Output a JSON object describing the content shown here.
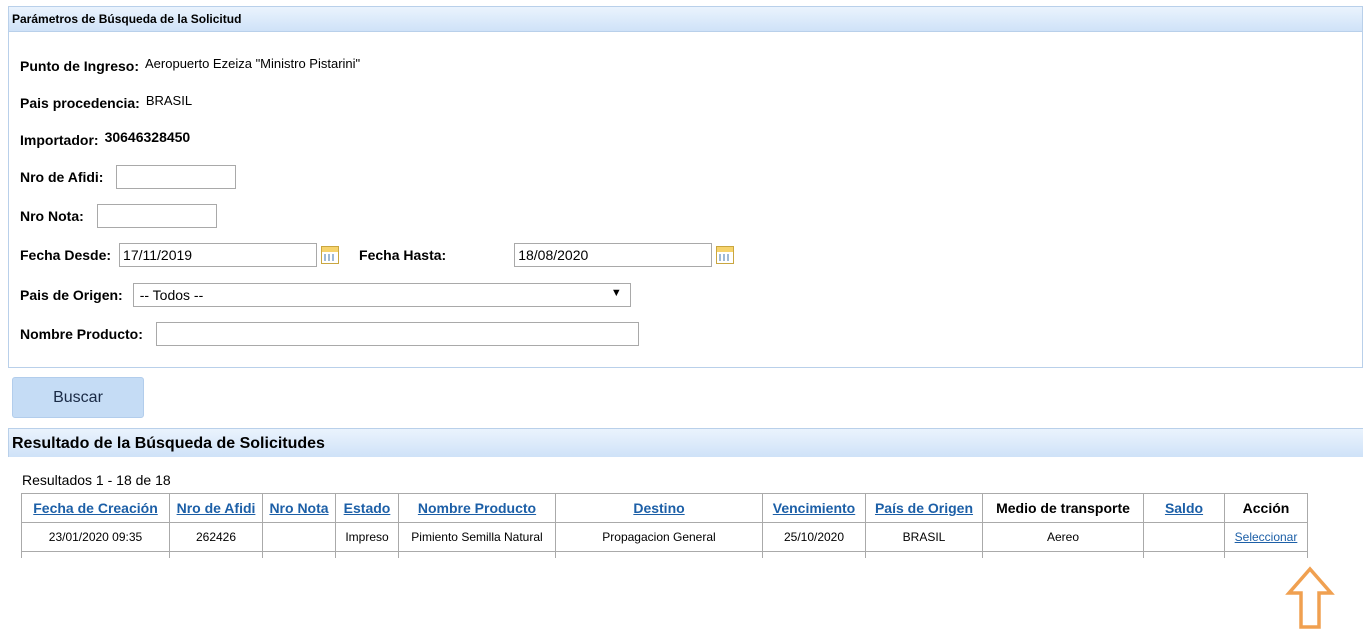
{
  "search_panel": {
    "title": "Parámetros de Búsqueda de la Solicitud",
    "punto_ingreso": {
      "label": "Punto de Ingreso:",
      "value": "Aeropuerto Ezeiza \"Ministro Pistarini\""
    },
    "pais_procedencia": {
      "label": "Pais procedencia:",
      "value": "BRASIL"
    },
    "importador": {
      "label": "Importador:",
      "value": "30646328450"
    },
    "nro_afidi": {
      "label": "Nro de Afidi:",
      "value": ""
    },
    "nro_nota": {
      "label": "Nro Nota:",
      "value": ""
    },
    "fecha_desde": {
      "label": "Fecha Desde:",
      "value": "17/11/2019"
    },
    "fecha_hasta": {
      "label": "Fecha Hasta:",
      "value": "18/08/2020"
    },
    "pais_origen": {
      "label": "Pais de Origen:",
      "selected": "-- Todos --"
    },
    "nombre_producto": {
      "label": "Nombre Producto:",
      "value": ""
    }
  },
  "buscar_label": "Buscar",
  "results_panel": {
    "title": "Resultado de la Búsqueda de Solicitudes",
    "summary": "Resultados 1 - 18 de 18",
    "columns": [
      "Fecha de Creación",
      "Nro de Afidi",
      "Nro Nota",
      "Estado",
      "Nombre Producto",
      "Destino",
      "Vencimiento",
      "País de Origen",
      "Medio de transporte",
      "Saldo",
      "Acción"
    ],
    "rows": [
      {
        "fecha": "23/01/2020 09:35",
        "afidi": "262426",
        "nota": "",
        "estado": "Impreso",
        "producto": "Pimiento Semilla Natural",
        "destino": "Propagacion General",
        "vencimiento": "25/10/2020",
        "pais": "BRASIL",
        "medio": "Aereo",
        "saldo": "",
        "accion": "Seleccionar"
      }
    ]
  },
  "colors": {
    "header_bg": "#cfe2f8",
    "link": "#1c5fa7",
    "arrow": "#f0a050",
    "button": "#c5dcf5"
  }
}
